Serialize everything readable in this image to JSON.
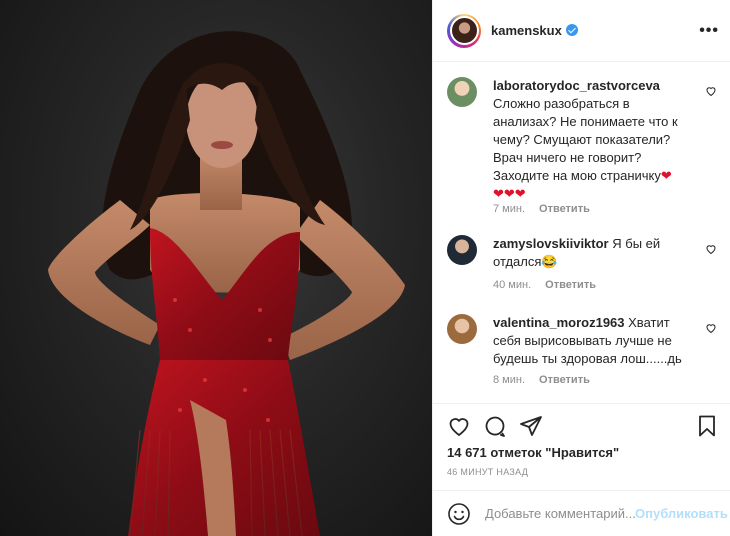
{
  "post": {
    "username": "kamenskux",
    "verified": true,
    "more_icon": "ellipsis-icon"
  },
  "comments": [
    {
      "username": "laboratorydoc_rastvorceva",
      "text": "Сложно разобраться в анализах? Не понимаете что к чему? Смущают показатели? Врач ничего не говорит? Заходите на мою страничку",
      "emoji_inline": "❤",
      "emoji_line": "❤❤❤",
      "time": "7 мин.",
      "reply": "Ответить"
    },
    {
      "username": "zamyslovskiiviktor",
      "text": "Я бы ей отдался",
      "emoji_inline": "😂",
      "time": "40 мин.",
      "reply": "Ответить"
    },
    {
      "username": "valentina_moroz1963",
      "text": "Хватит себя вырисовывать лучше не будешь ты здоровая лош......дь",
      "time": "8 мин.",
      "reply": "Ответить"
    }
  ],
  "actions": {
    "icons": [
      "heart-icon",
      "comment-icon",
      "share-icon",
      "bookmark-icon"
    ]
  },
  "likes": "14 671 отметок \"Нравится\"",
  "timestamp": "46 минут назад",
  "add_comment": {
    "placeholder": "Добавьте комментарий...",
    "post_label": "Опубликовать"
  },
  "colors": {
    "accent": "#3897f0",
    "post_disabled": "#b2dffc",
    "heart_red": "#e0112b",
    "dress_red": "#b0101c"
  }
}
